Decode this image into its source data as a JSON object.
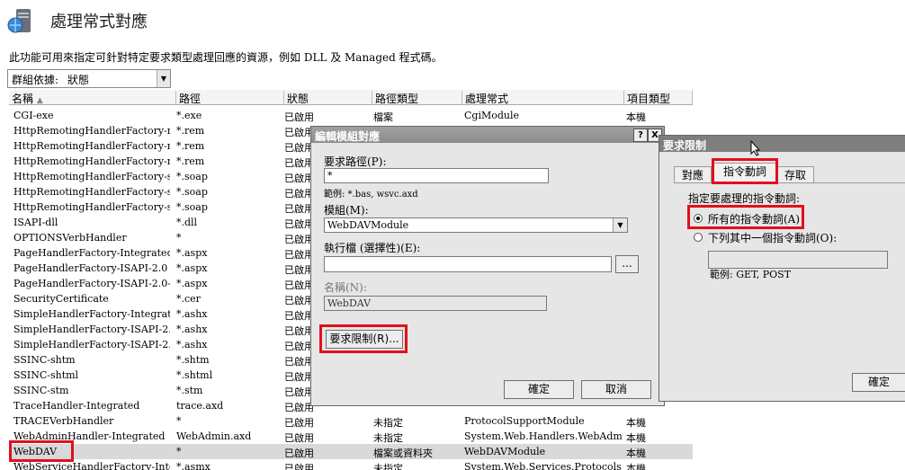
{
  "header": {
    "title": "處理常式對應",
    "icon": "server-globe-icon"
  },
  "description": "此功能可用來指定可針對特定要求類型處理回應的資源，例如 DLL 及 Managed 程式碼。",
  "group_by": {
    "label": "群組依據:",
    "value": "狀態"
  },
  "columns": [
    "名稱",
    "路徑",
    "狀態",
    "路徑類型",
    "處理常式",
    "項目類型"
  ],
  "rows": [
    [
      "CGI-exe",
      "*.exe",
      "已啟用",
      "檔案",
      "CgiModule",
      "本機"
    ],
    [
      "HttpRemotingHandlerFactory-rem...",
      "*.rem",
      "已啟用",
      "",
      "",
      ""
    ],
    [
      "HttpRemotingHandlerFactory-rem...",
      "*.rem",
      "已啟用",
      "",
      "",
      ""
    ],
    [
      "HttpRemotingHandlerFactory-rem...",
      "*.rem",
      "已啟用",
      "",
      "",
      ""
    ],
    [
      "HttpRemotingHandlerFactory-soap...",
      "*.soap",
      "已啟用",
      "",
      "",
      ""
    ],
    [
      "HttpRemotingHandlerFactory-soap...",
      "*.soap",
      "已啟用",
      "",
      "",
      ""
    ],
    [
      "HttpRemotingHandlerFactory-soap...",
      "*.soap",
      "已啟用",
      "",
      "",
      ""
    ],
    [
      "ISAPI-dll",
      "*.dll",
      "已啟用",
      "",
      "",
      ""
    ],
    [
      "OPTIONSVerbHandler",
      "*",
      "已啟用",
      "",
      "",
      ""
    ],
    [
      "PageHandlerFactory-Integrated",
      "*.aspx",
      "已啟用",
      "",
      "",
      ""
    ],
    [
      "PageHandlerFactory-ISAPI-2.0",
      "*.aspx",
      "已啟用",
      "",
      "",
      ""
    ],
    [
      "PageHandlerFactory-ISAPI-2.0-64",
      "*.aspx",
      "已啟用",
      "",
      "",
      ""
    ],
    [
      "SecurityCertificate",
      "*.cer",
      "已啟用",
      "",
      "",
      ""
    ],
    [
      "SimpleHandlerFactory-Integrated",
      "*.ashx",
      "已啟用",
      "",
      "",
      ""
    ],
    [
      "SimpleHandlerFactory-ISAPI-2.0",
      "*.ashx",
      "已啟用",
      "",
      "",
      ""
    ],
    [
      "SimpleHandlerFactory-ISAPI-2.0-64",
      "*.ashx",
      "已啟用",
      "",
      "",
      ""
    ],
    [
      "SSINC-shtm",
      "*.shtm",
      "已啟用",
      "",
      "",
      ""
    ],
    [
      "SSINC-shtml",
      "*.shtml",
      "已啟用",
      "",
      "",
      ""
    ],
    [
      "SSINC-stm",
      "*.stm",
      "已啟用",
      "",
      "",
      ""
    ],
    [
      "TraceHandler-Integrated",
      "trace.axd",
      "已啟用",
      "",
      "",
      ""
    ],
    [
      "TRACEVerbHandler",
      "*",
      "已啟用",
      "未指定",
      "ProtocolSupportModule",
      "本機"
    ],
    [
      "WebAdminHandler-Integrated",
      "WebAdmin.axd",
      "已啟用",
      "未指定",
      "System.Web.Handlers.WebAdmin...",
      "本機"
    ],
    [
      "WebDAV",
      "*",
      "已啟用",
      "檔案或資料夾",
      "WebDAVModule",
      "本機"
    ],
    [
      "WebServiceHandlerFactory-Integr...",
      "*.asmx",
      "已啟用",
      "未指定",
      "System.Web.Services.Protocols.W...",
      "本機"
    ]
  ],
  "dialog_edit": {
    "title": "編輯模組對應",
    "help_btn": "?",
    "close_btn": "X",
    "request_path_label": "要求路徑(P):",
    "request_path_value": "*",
    "example": "範例: *.bas, wsvc.axd",
    "module_label": "模組(M):",
    "module_value": "WebDAVModule",
    "executable_label": "執行檔 (選擇性)(E):",
    "executable_value": "",
    "browse_btn": "...",
    "name_label": "名稱(N):",
    "name_value": "WebDAV",
    "restrictions_btn": "要求限制(R)...",
    "ok_btn": "確定",
    "cancel_btn": "取消"
  },
  "dialog_restrict": {
    "title": "要求限制",
    "tabs": [
      "對應",
      "指令動詞",
      "存取"
    ],
    "prompt": "指定要處理的指令動詞:",
    "all_verbs": "所有的指令動詞(A)",
    "one_of": "下列其中一個指令動詞(O):",
    "verbs_value": "",
    "example": "範例: GET, POST",
    "ok_btn": "確定"
  }
}
